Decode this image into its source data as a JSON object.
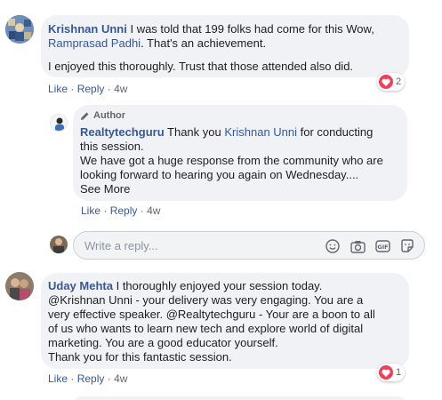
{
  "comments": [
    {
      "author": "Krishnan Unni",
      "text_line1": "I was told that 199 folks had come for this Wow,",
      "mention": "Ramprasad Padhi",
      "text_after_mention": ". That's an achievement.",
      "text_para2": "I enjoyed this thoroughly. Trust that those attended also did.",
      "like_label": "Like",
      "reply_label": "Reply",
      "separator": "·",
      "time": "4w",
      "reaction_count": "2"
    },
    {
      "author_badge": "Author",
      "author": "Realtytechguru",
      "text_line1_pre": "Thank you",
      "mention": "Krishnan Unni",
      "text_line1_post": "for conducting",
      "text_line2": "this session.",
      "text_line3": "We have got a huge response from the community who are",
      "text_line4": "looking forward to hearing you again on Wednesday....",
      "see_more": "See More",
      "like_label": "Like",
      "reply_label": "Reply",
      "separator": "·",
      "time": "4w"
    },
    {
      "author": "Uday Mehta",
      "text_line1": "I thoroughly enjoyed your session today.",
      "text_line2": "@Krishnan Unni - your delivery was very engaging. You are a",
      "text_line3": "very effective speaker. @Realtytechguru - Your are a boon to all",
      "text_line4": "of us who wants to learn new tech and explore world of digital",
      "text_line5": "marketing. You are a good educator yourself.",
      "text_line6": "Thank you for this fantastic session.",
      "like_label": "Like",
      "reply_label": "Reply",
      "separator": "·",
      "time": "4w",
      "reaction_count": "1"
    }
  ],
  "reply_input": {
    "placeholder": "Write a reply...",
    "icons": [
      "emoji-icon",
      "camera-icon",
      "gif-icon",
      "sticker-icon"
    ]
  },
  "colors": {
    "link": "#385898",
    "bubble": "#f0f2f5",
    "heart": "#f33e58",
    "muted": "#606770"
  }
}
